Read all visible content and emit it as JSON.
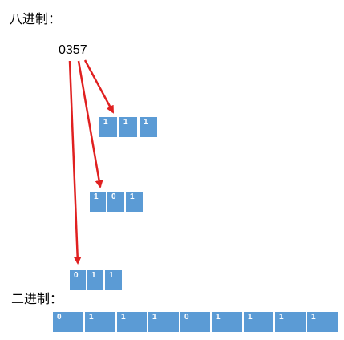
{
  "labels": {
    "octal_heading": "八进制：",
    "binary_heading": "二进制："
  },
  "octal_number": "0357",
  "groups": [
    {
      "bits": [
        "1",
        "1",
        "1"
      ]
    },
    {
      "bits": [
        "1",
        "0",
        "1"
      ]
    },
    {
      "bits": [
        "0",
        "1",
        "1"
      ]
    }
  ],
  "binary_bits": [
    "0",
    "1",
    "1",
    "1",
    "0",
    "1",
    "1",
    "1",
    "1"
  ],
  "colors": {
    "cell_fill": "#5b9bd5",
    "arrow": "#e02020"
  }
}
